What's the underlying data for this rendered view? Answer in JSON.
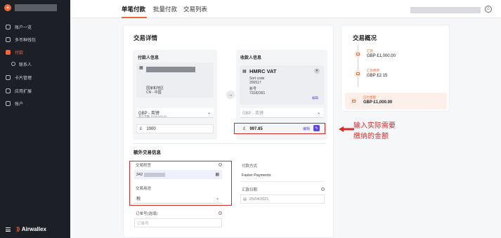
{
  "sidebar": {
    "items": [
      {
        "label": "账户一览"
      },
      {
        "label": "多币种钱包"
      },
      {
        "label": "付款"
      },
      {
        "label": "联系人"
      },
      {
        "label": "卡片管理"
      },
      {
        "label": "应用扩展"
      },
      {
        "label": "账户"
      }
    ],
    "brand": "Airwallex"
  },
  "tabs": [
    {
      "label": "单笔付款"
    },
    {
      "label": "批量付款"
    },
    {
      "label": "交易列表"
    }
  ],
  "details": {
    "title": "交易详情",
    "payer": {
      "title": "付款人信息",
      "country_label": "国家和地区",
      "country_value": "CN - 中国",
      "currency": "GBP - 英镑",
      "limit": "我方余额: £100,000.00",
      "currency_symbol": "£",
      "amount": "1000"
    },
    "payee": {
      "title": "收款人信息",
      "name": "HMRC VAT",
      "sort_code_label": "Sort code",
      "sort_code": "200517",
      "account_label": "账号",
      "account": "73182391",
      "edit": "编辑",
      "currency": "GBP - 英镑",
      "currency_symbol": "£",
      "amount": "997.85",
      "amount_edit": "编辑"
    }
  },
  "extra": {
    "title": "额外交易信息",
    "reference_label": "交易附言",
    "reference_value": "342",
    "purpose_label": "交易用途",
    "purpose_value": "税",
    "payment_method_label": "付款方式",
    "payment_method_value": "Faster Payments",
    "date_label": "汇款日期",
    "date_value": "25/04/2021",
    "order_label": "订单号(选填)",
    "order_placeholder": "订单号"
  },
  "overview": {
    "title": "交易概况",
    "sent_label": "汇款",
    "sent_value": "GBP £1,000.00",
    "fee_label": "汇款费用",
    "fee_value": "GBP £2.15",
    "total_label": "应付金额",
    "total_value": "GBP £1,000.00"
  },
  "annotation": {
    "line1": "输入实际需要",
    "line2": "缴纳的金额"
  },
  "colors": {
    "accent": "#f0683a",
    "annotation": "#d42a2a",
    "purple": "#5b4bd6",
    "sidebar_bg": "#1c1f26"
  }
}
